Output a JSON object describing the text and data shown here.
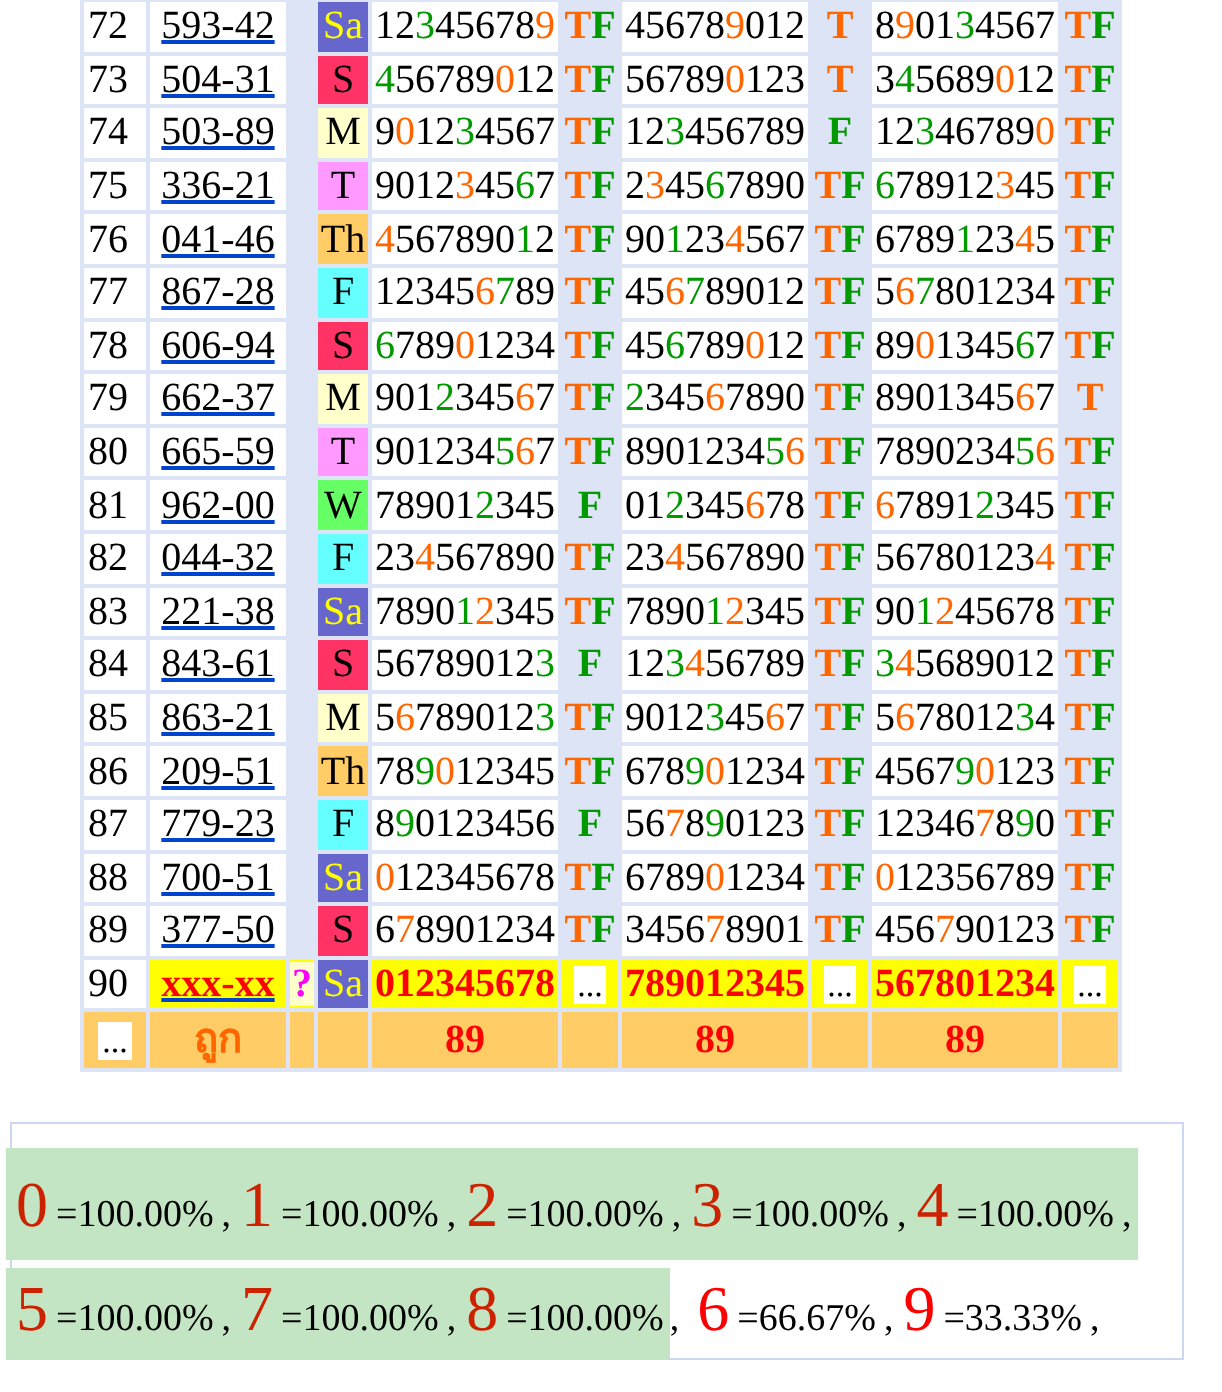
{
  "rows": [
    {
      "kind": "result",
      "index": "72",
      "code": "593-42",
      "day": "Sa",
      "color": "#6666cc",
      "draws": [
        {
          "parts": [
            {
              "text": "12",
              "kind": "plain"
            },
            {
              "text": "3",
              "kind": "hit"
            },
            {
              "text": "45678",
              "kind": "plain"
            },
            {
              "text": "9",
              "kind": "near"
            }
          ],
          "mark": [
            {
              "text": "T",
              "kind": "near"
            },
            {
              "text": "F",
              "kind": "hit"
            }
          ]
        },
        {
          "parts": [
            {
              "text": "45678",
              "kind": "plain"
            },
            {
              "text": "9",
              "kind": "near"
            },
            {
              "text": "012",
              "kind": "plain"
            }
          ],
          "mark": [
            {
              "text": "T",
              "kind": "near"
            }
          ]
        },
        {
          "parts": [
            {
              "text": "8",
              "kind": "plain"
            },
            {
              "text": "9",
              "kind": "near"
            },
            {
              "text": "01",
              "kind": "plain"
            },
            {
              "text": "3",
              "kind": "hit"
            },
            {
              "text": "4567",
              "kind": "plain"
            }
          ],
          "mark": [
            {
              "text": "T",
              "kind": "near"
            },
            {
              "text": "F",
              "kind": "hit"
            }
          ]
        }
      ]
    },
    {
      "kind": "result",
      "index": "73",
      "code": "504-31",
      "day": "S",
      "color": "#ff3366",
      "draws": [
        {
          "parts": [
            {
              "text": "4",
              "kind": "hit"
            },
            {
              "text": "56789",
              "kind": "plain"
            },
            {
              "text": "0",
              "kind": "near"
            },
            {
              "text": "12",
              "kind": "plain"
            }
          ],
          "mark": [
            {
              "text": "T",
              "kind": "near"
            },
            {
              "text": "F",
              "kind": "hit"
            }
          ]
        },
        {
          "parts": [
            {
              "text": "56789",
              "kind": "plain"
            },
            {
              "text": "0",
              "kind": "near"
            },
            {
              "text": "123",
              "kind": "plain"
            }
          ],
          "mark": [
            {
              "text": "T",
              "kind": "near"
            }
          ]
        },
        {
          "parts": [
            {
              "text": "3",
              "kind": "plain"
            },
            {
              "text": "4",
              "kind": "hit"
            },
            {
              "text": "5689",
              "kind": "plain"
            },
            {
              "text": "0",
              "kind": "near"
            },
            {
              "text": "12",
              "kind": "plain"
            }
          ],
          "mark": [
            {
              "text": "T",
              "kind": "near"
            },
            {
              "text": "F",
              "kind": "hit"
            }
          ]
        }
      ]
    },
    {
      "kind": "result",
      "index": "74",
      "code": "503-89",
      "day": "M",
      "color": "#ffffcc",
      "draws": [
        {
          "parts": [
            {
              "text": "9",
              "kind": "plain"
            },
            {
              "text": "0",
              "kind": "near"
            },
            {
              "text": "12",
              "kind": "plain"
            },
            {
              "text": "3",
              "kind": "hit"
            },
            {
              "text": "4567",
              "kind": "plain"
            }
          ],
          "mark": [
            {
              "text": "T",
              "kind": "near"
            },
            {
              "text": "F",
              "kind": "hit"
            }
          ]
        },
        {
          "parts": [
            {
              "text": "12",
              "kind": "plain"
            },
            {
              "text": "3",
              "kind": "hit"
            },
            {
              "text": "456789",
              "kind": "plain"
            }
          ],
          "mark": [
            {
              "text": "F",
              "kind": "hit"
            }
          ]
        },
        {
          "parts": [
            {
              "text": "12",
              "kind": "plain"
            },
            {
              "text": "3",
              "kind": "hit"
            },
            {
              "text": "46789",
              "kind": "plain"
            },
            {
              "text": "0",
              "kind": "near"
            }
          ],
          "mark": [
            {
              "text": "T",
              "kind": "near"
            },
            {
              "text": "F",
              "kind": "hit"
            }
          ]
        }
      ]
    },
    {
      "kind": "result",
      "index": "75",
      "code": "336-21",
      "day": "T",
      "color": "#ff99ff",
      "draws": [
        {
          "parts": [
            {
              "text": "9012",
              "kind": "plain"
            },
            {
              "text": "3",
              "kind": "near"
            },
            {
              "text": "45",
              "kind": "plain"
            },
            {
              "text": "6",
              "kind": "hit"
            },
            {
              "text": "7",
              "kind": "plain"
            }
          ],
          "mark": [
            {
              "text": "T",
              "kind": "near"
            },
            {
              "text": "F",
              "kind": "hit"
            }
          ]
        },
        {
          "parts": [
            {
              "text": "2",
              "kind": "plain"
            },
            {
              "text": "3",
              "kind": "near"
            },
            {
              "text": "45",
              "kind": "plain"
            },
            {
              "text": "6",
              "kind": "hit"
            },
            {
              "text": "7890",
              "kind": "plain"
            }
          ],
          "mark": [
            {
              "text": "T",
              "kind": "near"
            },
            {
              "text": "F",
              "kind": "hit"
            }
          ]
        },
        {
          "parts": [
            {
              "text": "6",
              "kind": "hit"
            },
            {
              "text": "78912",
              "kind": "plain"
            },
            {
              "text": "3",
              "kind": "near"
            },
            {
              "text": "45",
              "kind": "plain"
            }
          ],
          "mark": [
            {
              "text": "T",
              "kind": "near"
            },
            {
              "text": "F",
              "kind": "hit"
            }
          ]
        }
      ]
    },
    {
      "kind": "result",
      "index": "76",
      "code": "041-46",
      "day": "Th",
      "color": "#ffcc66",
      "draws": [
        {
          "parts": [
            {
              "text": "4",
              "kind": "near"
            },
            {
              "text": "567890",
              "kind": "plain"
            },
            {
              "text": "1",
              "kind": "hit"
            },
            {
              "text": "2",
              "kind": "plain"
            }
          ],
          "mark": [
            {
              "text": "T",
              "kind": "near"
            },
            {
              "text": "F",
              "kind": "hit"
            }
          ]
        },
        {
          "parts": [
            {
              "text": "90",
              "kind": "plain"
            },
            {
              "text": "1",
              "kind": "hit"
            },
            {
              "text": "23",
              "kind": "plain"
            },
            {
              "text": "4",
              "kind": "near"
            },
            {
              "text": "567",
              "kind": "plain"
            }
          ],
          "mark": [
            {
              "text": "T",
              "kind": "near"
            },
            {
              "text": "F",
              "kind": "hit"
            }
          ]
        },
        {
          "parts": [
            {
              "text": "6789",
              "kind": "plain"
            },
            {
              "text": "1",
              "kind": "hit"
            },
            {
              "text": "23",
              "kind": "plain"
            },
            {
              "text": "4",
              "kind": "near"
            },
            {
              "text": "5",
              "kind": "plain"
            }
          ],
          "mark": [
            {
              "text": "T",
              "kind": "near"
            },
            {
              "text": "F",
              "kind": "hit"
            }
          ]
        }
      ]
    },
    {
      "kind": "result",
      "index": "77",
      "code": "867-28",
      "day": "F",
      "color": "#66ffff",
      "draws": [
        {
          "parts": [
            {
              "text": "12345",
              "kind": "plain"
            },
            {
              "text": "6",
              "kind": "near"
            },
            {
              "text": "7",
              "kind": "hit"
            },
            {
              "text": "89",
              "kind": "plain"
            }
          ],
          "mark": [
            {
              "text": "T",
              "kind": "near"
            },
            {
              "text": "F",
              "kind": "hit"
            }
          ]
        },
        {
          "parts": [
            {
              "text": "45",
              "kind": "plain"
            },
            {
              "text": "6",
              "kind": "near"
            },
            {
              "text": "7",
              "kind": "hit"
            },
            {
              "text": "89012",
              "kind": "plain"
            }
          ],
          "mark": [
            {
              "text": "T",
              "kind": "near"
            },
            {
              "text": "F",
              "kind": "hit"
            }
          ]
        },
        {
          "parts": [
            {
              "text": "5",
              "kind": "plain"
            },
            {
              "text": "6",
              "kind": "near"
            },
            {
              "text": "7",
              "kind": "hit"
            },
            {
              "text": "801234",
              "kind": "plain"
            }
          ],
          "mark": [
            {
              "text": "T",
              "kind": "near"
            },
            {
              "text": "F",
              "kind": "hit"
            }
          ]
        }
      ]
    },
    {
      "kind": "result",
      "index": "78",
      "code": "606-94",
      "day": "S",
      "color": "#ff3366",
      "draws": [
        {
          "parts": [
            {
              "text": "6",
              "kind": "hit"
            },
            {
              "text": "789",
              "kind": "plain"
            },
            {
              "text": "0",
              "kind": "near"
            },
            {
              "text": "1234",
              "kind": "plain"
            }
          ],
          "mark": [
            {
              "text": "T",
              "kind": "near"
            },
            {
              "text": "F",
              "kind": "hit"
            }
          ]
        },
        {
          "parts": [
            {
              "text": "45",
              "kind": "plain"
            },
            {
              "text": "6",
              "kind": "hit"
            },
            {
              "text": "789",
              "kind": "plain"
            },
            {
              "text": "0",
              "kind": "near"
            },
            {
              "text": "12",
              "kind": "plain"
            }
          ],
          "mark": [
            {
              "text": "T",
              "kind": "near"
            },
            {
              "text": "F",
              "kind": "hit"
            }
          ]
        },
        {
          "parts": [
            {
              "text": "89",
              "kind": "plain"
            },
            {
              "text": "0",
              "kind": "near"
            },
            {
              "text": "1345",
              "kind": "plain"
            },
            {
              "text": "6",
              "kind": "hit"
            },
            {
              "text": "7",
              "kind": "plain"
            }
          ],
          "mark": [
            {
              "text": "T",
              "kind": "near"
            },
            {
              "text": "F",
              "kind": "hit"
            }
          ]
        }
      ]
    },
    {
      "kind": "result",
      "index": "79",
      "code": "662-37",
      "day": "M",
      "color": "#ffffcc",
      "draws": [
        {
          "parts": [
            {
              "text": "901",
              "kind": "plain"
            },
            {
              "text": "2",
              "kind": "hit"
            },
            {
              "text": "345",
              "kind": "plain"
            },
            {
              "text": "6",
              "kind": "near"
            },
            {
              "text": "7",
              "kind": "plain"
            }
          ],
          "mark": [
            {
              "text": "T",
              "kind": "near"
            },
            {
              "text": "F",
              "kind": "hit"
            }
          ]
        },
        {
          "parts": [
            {
              "text": "2",
              "kind": "hit"
            },
            {
              "text": "345",
              "kind": "plain"
            },
            {
              "text": "6",
              "kind": "near"
            },
            {
              "text": "7890",
              "kind": "plain"
            }
          ],
          "mark": [
            {
              "text": "T",
              "kind": "near"
            },
            {
              "text": "F",
              "kind": "hit"
            }
          ]
        },
        {
          "parts": [
            {
              "text": "8901345",
              "kind": "plain"
            },
            {
              "text": "6",
              "kind": "near"
            },
            {
              "text": "7",
              "kind": "plain"
            }
          ],
          "mark": [
            {
              "text": "T",
              "kind": "near"
            }
          ]
        }
      ]
    },
    {
      "kind": "result",
      "index": "80",
      "code": "665-59",
      "day": "T",
      "color": "#ff99ff",
      "draws": [
        {
          "parts": [
            {
              "text": "901234",
              "kind": "plain"
            },
            {
              "text": "5",
              "kind": "hit"
            },
            {
              "text": "6",
              "kind": "near"
            },
            {
              "text": "7",
              "kind": "plain"
            }
          ],
          "mark": [
            {
              "text": "T",
              "kind": "near"
            },
            {
              "text": "F",
              "kind": "hit"
            }
          ]
        },
        {
          "parts": [
            {
              "text": "8901234",
              "kind": "plain"
            },
            {
              "text": "5",
              "kind": "hit"
            },
            {
              "text": "6",
              "kind": "near"
            }
          ],
          "mark": [
            {
              "text": "T",
              "kind": "near"
            },
            {
              "text": "F",
              "kind": "hit"
            }
          ]
        },
        {
          "parts": [
            {
              "text": "7890234",
              "kind": "plain"
            },
            {
              "text": "5",
              "kind": "hit"
            },
            {
              "text": "6",
              "kind": "near"
            }
          ],
          "mark": [
            {
              "text": "T",
              "kind": "near"
            },
            {
              "text": "F",
              "kind": "hit"
            }
          ]
        }
      ]
    },
    {
      "kind": "result",
      "index": "81",
      "code": "962-00",
      "day": "W",
      "color": "#66ff66",
      "draws": [
        {
          "parts": [
            {
              "text": "78901",
              "kind": "plain"
            },
            {
              "text": "2",
              "kind": "hit"
            },
            {
              "text": "345",
              "kind": "plain"
            }
          ],
          "mark": [
            {
              "text": "F",
              "kind": "hit"
            }
          ]
        },
        {
          "parts": [
            {
              "text": "01",
              "kind": "plain"
            },
            {
              "text": "2",
              "kind": "hit"
            },
            {
              "text": "345",
              "kind": "plain"
            },
            {
              "text": "6",
              "kind": "near"
            },
            {
              "text": "78",
              "kind": "plain"
            }
          ],
          "mark": [
            {
              "text": "T",
              "kind": "near"
            },
            {
              "text": "F",
              "kind": "hit"
            }
          ]
        },
        {
          "parts": [
            {
              "text": "6",
              "kind": "near"
            },
            {
              "text": "7891",
              "kind": "plain"
            },
            {
              "text": "2",
              "kind": "hit"
            },
            {
              "text": "345",
              "kind": "plain"
            }
          ],
          "mark": [
            {
              "text": "T",
              "kind": "near"
            },
            {
              "text": "F",
              "kind": "hit"
            }
          ]
        }
      ]
    },
    {
      "kind": "result",
      "index": "82",
      "code": "044-32",
      "day": "F",
      "color": "#66ffff",
      "draws": [
        {
          "parts": [
            {
              "text": "23",
              "kind": "plain"
            },
            {
              "text": "4",
              "kind": "near"
            },
            {
              "text": "567890",
              "kind": "plain"
            }
          ],
          "mark": [
            {
              "text": "T",
              "kind": "near"
            },
            {
              "text": "F",
              "kind": "hit"
            }
          ]
        },
        {
          "parts": [
            {
              "text": "23",
              "kind": "plain"
            },
            {
              "text": "4",
              "kind": "near"
            },
            {
              "text": "567890",
              "kind": "plain"
            }
          ],
          "mark": [
            {
              "text": "T",
              "kind": "near"
            },
            {
              "text": "F",
              "kind": "hit"
            }
          ]
        },
        {
          "parts": [
            {
              "text": "56780123",
              "kind": "plain"
            },
            {
              "text": "4",
              "kind": "near"
            }
          ],
          "mark": [
            {
              "text": "T",
              "kind": "near"
            },
            {
              "text": "F",
              "kind": "hit"
            }
          ]
        }
      ]
    },
    {
      "kind": "result",
      "index": "83",
      "code": "221-38",
      "day": "Sa",
      "color": "#6666cc",
      "draws": [
        {
          "parts": [
            {
              "text": "7890",
              "kind": "plain"
            },
            {
              "text": "1",
              "kind": "hit"
            },
            {
              "text": "2",
              "kind": "near"
            },
            {
              "text": "345",
              "kind": "plain"
            }
          ],
          "mark": [
            {
              "text": "T",
              "kind": "near"
            },
            {
              "text": "F",
              "kind": "hit"
            }
          ]
        },
        {
          "parts": [
            {
              "text": "7890",
              "kind": "plain"
            },
            {
              "text": "1",
              "kind": "hit"
            },
            {
              "text": "2",
              "kind": "near"
            },
            {
              "text": "345",
              "kind": "plain"
            }
          ],
          "mark": [
            {
              "text": "T",
              "kind": "near"
            },
            {
              "text": "F",
              "kind": "hit"
            }
          ]
        },
        {
          "parts": [
            {
              "text": "90",
              "kind": "plain"
            },
            {
              "text": "1",
              "kind": "hit"
            },
            {
              "text": "2",
              "kind": "near"
            },
            {
              "text": "45678",
              "kind": "plain"
            }
          ],
          "mark": [
            {
              "text": "T",
              "kind": "near"
            },
            {
              "text": "F",
              "kind": "hit"
            }
          ]
        }
      ]
    },
    {
      "kind": "result",
      "index": "84",
      "code": "843-61",
      "day": "S",
      "color": "#ff3366",
      "draws": [
        {
          "parts": [
            {
              "text": "56789012",
              "kind": "plain"
            },
            {
              "text": "3",
              "kind": "hit"
            }
          ],
          "mark": [
            {
              "text": "F",
              "kind": "hit"
            }
          ]
        },
        {
          "parts": [
            {
              "text": "12",
              "kind": "plain"
            },
            {
              "text": "3",
              "kind": "hit"
            },
            {
              "text": "4",
              "kind": "near"
            },
            {
              "text": "56789",
              "kind": "plain"
            }
          ],
          "mark": [
            {
              "text": "T",
              "kind": "near"
            },
            {
              "text": "F",
              "kind": "hit"
            }
          ]
        },
        {
          "parts": [
            {
              "text": "3",
              "kind": "hit"
            },
            {
              "text": "4",
              "kind": "near"
            },
            {
              "text": "5689012",
              "kind": "plain"
            }
          ],
          "mark": [
            {
              "text": "T",
              "kind": "near"
            },
            {
              "text": "F",
              "kind": "hit"
            }
          ]
        }
      ]
    },
    {
      "kind": "result",
      "index": "85",
      "code": "863-21",
      "day": "M",
      "color": "#ffffcc",
      "draws": [
        {
          "parts": [
            {
              "text": "5",
              "kind": "plain"
            },
            {
              "text": "6",
              "kind": "near"
            },
            {
              "text": "789012",
              "kind": "plain"
            },
            {
              "text": "3",
              "kind": "hit"
            }
          ],
          "mark": [
            {
              "text": "T",
              "kind": "near"
            },
            {
              "text": "F",
              "kind": "hit"
            }
          ]
        },
        {
          "parts": [
            {
              "text": "9012",
              "kind": "plain"
            },
            {
              "text": "3",
              "kind": "hit"
            },
            {
              "text": "45",
              "kind": "plain"
            },
            {
              "text": "6",
              "kind": "near"
            },
            {
              "text": "7",
              "kind": "plain"
            }
          ],
          "mark": [
            {
              "text": "T",
              "kind": "near"
            },
            {
              "text": "F",
              "kind": "hit"
            }
          ]
        },
        {
          "parts": [
            {
              "text": "5",
              "kind": "plain"
            },
            {
              "text": "6",
              "kind": "near"
            },
            {
              "text": "78012",
              "kind": "plain"
            },
            {
              "text": "3",
              "kind": "hit"
            },
            {
              "text": "4",
              "kind": "plain"
            }
          ],
          "mark": [
            {
              "text": "T",
              "kind": "near"
            },
            {
              "text": "F",
              "kind": "hit"
            }
          ]
        }
      ]
    },
    {
      "kind": "result",
      "index": "86",
      "code": "209-51",
      "day": "Th",
      "color": "#ffcc66",
      "draws": [
        {
          "parts": [
            {
              "text": "78",
              "kind": "plain"
            },
            {
              "text": "9",
              "kind": "hit"
            },
            {
              "text": "0",
              "kind": "near"
            },
            {
              "text": "12345",
              "kind": "plain"
            }
          ],
          "mark": [
            {
              "text": "T",
              "kind": "near"
            },
            {
              "text": "F",
              "kind": "hit"
            }
          ]
        },
        {
          "parts": [
            {
              "text": "678",
              "kind": "plain"
            },
            {
              "text": "9",
              "kind": "hit"
            },
            {
              "text": "0",
              "kind": "near"
            },
            {
              "text": "1234",
              "kind": "plain"
            }
          ],
          "mark": [
            {
              "text": "T",
              "kind": "near"
            },
            {
              "text": "F",
              "kind": "hit"
            }
          ]
        },
        {
          "parts": [
            {
              "text": "4567",
              "kind": "plain"
            },
            {
              "text": "9",
              "kind": "hit"
            },
            {
              "text": "0",
              "kind": "near"
            },
            {
              "text": "123",
              "kind": "plain"
            }
          ],
          "mark": [
            {
              "text": "T",
              "kind": "near"
            },
            {
              "text": "F",
              "kind": "hit"
            }
          ]
        }
      ]
    },
    {
      "kind": "result",
      "index": "87",
      "code": "779-23",
      "day": "F",
      "color": "#66ffff",
      "draws": [
        {
          "parts": [
            {
              "text": "8",
              "kind": "plain"
            },
            {
              "text": "9",
              "kind": "hit"
            },
            {
              "text": "0123456",
              "kind": "plain"
            }
          ],
          "mark": [
            {
              "text": "F",
              "kind": "hit"
            }
          ]
        },
        {
          "parts": [
            {
              "text": "56",
              "kind": "plain"
            },
            {
              "text": "7",
              "kind": "near"
            },
            {
              "text": "8",
              "kind": "plain"
            },
            {
              "text": "9",
              "kind": "hit"
            },
            {
              "text": "0123",
              "kind": "plain"
            }
          ],
          "mark": [
            {
              "text": "T",
              "kind": "near"
            },
            {
              "text": "F",
              "kind": "hit"
            }
          ]
        },
        {
          "parts": [
            {
              "text": "12346",
              "kind": "plain"
            },
            {
              "text": "7",
              "kind": "near"
            },
            {
              "text": "8",
              "kind": "plain"
            },
            {
              "text": "9",
              "kind": "hit"
            },
            {
              "text": "0",
              "kind": "plain"
            }
          ],
          "mark": [
            {
              "text": "T",
              "kind": "near"
            },
            {
              "text": "F",
              "kind": "hit"
            }
          ]
        }
      ]
    },
    {
      "kind": "result",
      "index": "88",
      "code": "700-51",
      "day": "Sa",
      "color": "#6666cc",
      "draws": [
        {
          "parts": [
            {
              "text": "0",
              "kind": "near"
            },
            {
              "text": "12345678",
              "kind": "plain"
            }
          ],
          "mark": [
            {
              "text": "T",
              "kind": "near"
            },
            {
              "text": "F",
              "kind": "hit"
            }
          ]
        },
        {
          "parts": [
            {
              "text": "6789",
              "kind": "plain"
            },
            {
              "text": "0",
              "kind": "near"
            },
            {
              "text": "1234",
              "kind": "plain"
            }
          ],
          "mark": [
            {
              "text": "T",
              "kind": "near"
            },
            {
              "text": "F",
              "kind": "hit"
            }
          ]
        },
        {
          "parts": [
            {
              "text": "0",
              "kind": "near"
            },
            {
              "text": "12356789",
              "kind": "plain"
            }
          ],
          "mark": [
            {
              "text": "T",
              "kind": "near"
            },
            {
              "text": "F",
              "kind": "hit"
            }
          ]
        }
      ]
    },
    {
      "kind": "result",
      "index": "89",
      "code": "377-50",
      "day": "S",
      "color": "#ff3366",
      "draws": [
        {
          "parts": [
            {
              "text": "6",
              "kind": "plain"
            },
            {
              "text": "7",
              "kind": "near"
            },
            {
              "text": "8901234",
              "kind": "plain"
            }
          ],
          "mark": [
            {
              "text": "T",
              "kind": "near"
            },
            {
              "text": "F",
              "kind": "hit"
            }
          ]
        },
        {
          "parts": [
            {
              "text": "3456",
              "kind": "plain"
            },
            {
              "text": "7",
              "kind": "near"
            },
            {
              "text": "8901",
              "kind": "plain"
            }
          ],
          "mark": [
            {
              "text": "T",
              "kind": "near"
            },
            {
              "text": "F",
              "kind": "hit"
            }
          ]
        },
        {
          "parts": [
            {
              "text": "456",
              "kind": "plain"
            },
            {
              "text": "7",
              "kind": "near"
            },
            {
              "text": "90123",
              "kind": "plain"
            }
          ],
          "mark": [
            {
              "text": "T",
              "kind": "near"
            },
            {
              "text": "F",
              "kind": "hit"
            }
          ]
        }
      ]
    },
    {
      "kind": "pending",
      "index": "90",
      "code": "xxx-xx",
      "query": "?",
      "day": "Sa",
      "color": "#6666cc",
      "draws": [
        {
          "parts": [
            {
              "text": "012345678",
              "kind": "plain"
            }
          ],
          "mark": [
            {
              "text": "...",
              "kind": "pending"
            }
          ]
        },
        {
          "parts": [
            {
              "text": "789012345",
              "kind": "plain"
            }
          ],
          "mark": [
            {
              "text": "...",
              "kind": "pending"
            }
          ]
        },
        {
          "parts": [
            {
              "text": "567801234",
              "kind": "plain"
            }
          ],
          "mark": [
            {
              "text": "...",
              "kind": "pending"
            }
          ]
        }
      ]
    }
  ],
  "footer": {
    "lead": "...",
    "label": "ถูก",
    "counts": [
      "89",
      "89",
      "89"
    ]
  },
  "legend": {
    "lines": [
      [
        {
          "hit": true,
          "items": [
            {
              "digit": "0",
              "value": "=100.00%",
              "sep": ","
            },
            {
              "digit": "1",
              "value": "=100.00%",
              "sep": ","
            },
            {
              "digit": "2",
              "value": "=100.00%",
              "sep": ","
            },
            {
              "digit": "3",
              "value": "=100.00%",
              "sep": ","
            },
            {
              "digit": "4",
              "value": "=100.00%",
              "sep": ","
            }
          ]
        }
      ],
      [
        {
          "hit": true,
          "items": [
            {
              "digit": "5",
              "value": "=100.00%",
              "sep": ","
            },
            {
              "digit": "7",
              "value": "=100.00%",
              "sep": ","
            },
            {
              "digit": "8",
              "value": "=100.00%"
            }
          ]
        },
        {
          "hit": false,
          "lead": ",",
          "items": [
            {
              "digit": "6",
              "value": "=66.67%",
              "sep": ","
            },
            {
              "digit": "9",
              "value": "=33.33%",
              "sep": ","
            }
          ]
        }
      ]
    ]
  }
}
